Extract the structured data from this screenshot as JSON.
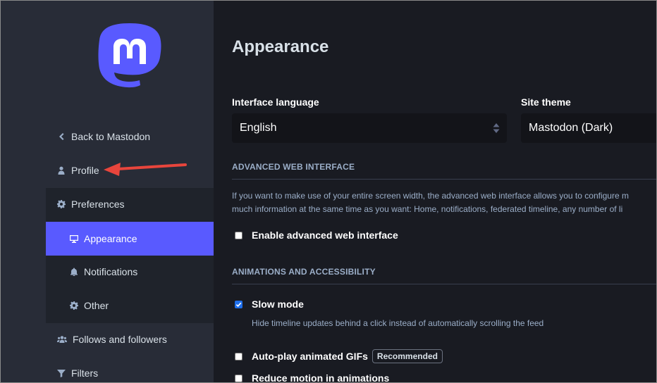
{
  "sidebar": {
    "brand_color": "#595aff",
    "items": [
      {
        "key": "back",
        "label": "Back to Mastodon",
        "icon": "chevron-left-icon"
      },
      {
        "key": "profile",
        "label": "Profile",
        "icon": "user-icon"
      },
      {
        "key": "preferences",
        "label": "Preferences",
        "icon": "gear-icon"
      },
      {
        "key": "appearance",
        "label": "Appearance",
        "icon": "desktop-icon",
        "active": true
      },
      {
        "key": "notifications",
        "label": "Notifications",
        "icon": "bell-icon"
      },
      {
        "key": "other",
        "label": "Other",
        "icon": "gear-icon"
      },
      {
        "key": "follows",
        "label": "Follows and followers",
        "icon": "users-icon"
      },
      {
        "key": "filters",
        "label": "Filters",
        "icon": "filter-icon"
      }
    ]
  },
  "main": {
    "title": "Appearance",
    "interface_language": {
      "label": "Interface language",
      "value": "English"
    },
    "site_theme": {
      "label": "Site theme",
      "value": "Mastodon (Dark)"
    },
    "advanced": {
      "heading": "ADVANCED WEB INTERFACE",
      "description_line1": "If you want to make use of your entire screen width, the advanced web interface allows you to configure m",
      "description_line2": "much information at the same time as you want: Home, notifications, federated timeline, any number of li",
      "checkbox_label": "Enable advanced web interface",
      "checked": false
    },
    "animations": {
      "heading": "ANIMATIONS AND ACCESSIBILITY",
      "slow_mode": {
        "label": "Slow mode",
        "checked": true,
        "hint": "Hide timeline updates behind a click instead of automatically scrolling the feed"
      },
      "autoplay": {
        "label": "Auto-play animated GIFs",
        "badge": "Recommended",
        "checked": false
      },
      "reduce_motion": {
        "label": "Reduce motion in animations",
        "checked": false
      }
    }
  },
  "annotation": {
    "arrow_color": "#e8453c"
  }
}
